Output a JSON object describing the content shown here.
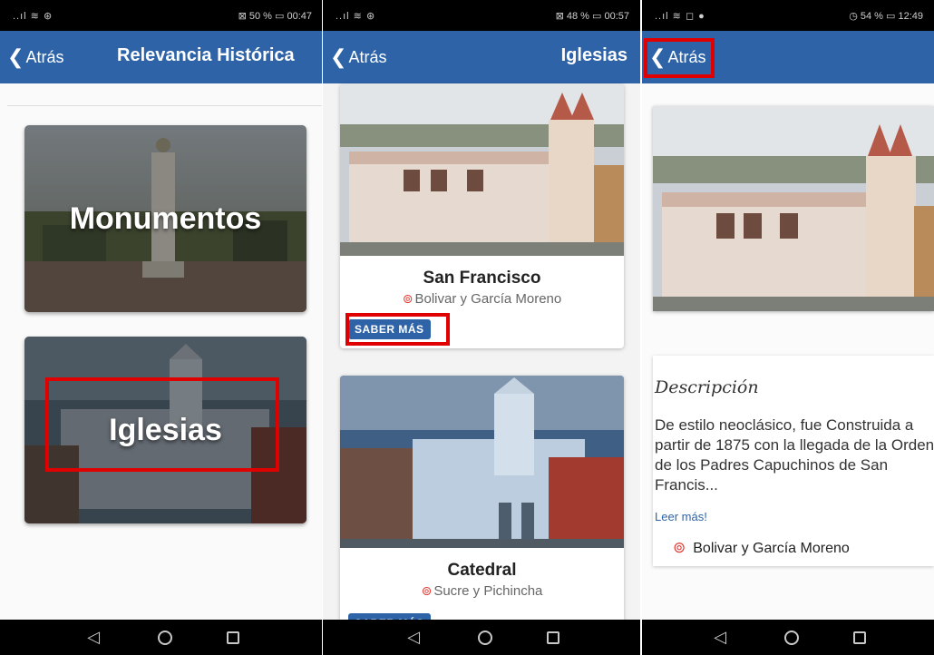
{
  "screens": [
    {
      "status_left": "..ıl ≋ ⊛",
      "status_right": "⊠ 50 % ▭ 00:47",
      "back_label": "Atrás",
      "title": "Relevancia Histórica",
      "categories": [
        {
          "label": "Monumentos"
        },
        {
          "label": "Iglesias"
        }
      ]
    },
    {
      "status_left": "..ıl ≋ ⊛",
      "status_right": "⊠ 48 % ▭ 00:57",
      "back_label": "Atrás",
      "title": "Iglesias",
      "churches": [
        {
          "name": "San Francisco",
          "address": "Bolivar y García Moreno",
          "button": "SABER MÁS"
        },
        {
          "name": "Catedral",
          "address": "Sucre y Pichincha",
          "button": "SABER MÁS"
        }
      ]
    },
    {
      "status_left": "..ıl ≋ ◻ ●",
      "status_right": "◷ 54 % ▭ 12:49",
      "back_label": "Atrás",
      "description_heading": "Descripción",
      "description_text": "De estilo neoclásico, fue Construida a partir de 1875 con la llegada de la Orden de los Padres Capuchinos de San Francis...",
      "read_more": "Leer más!",
      "address": "Bolivar y García Moreno"
    }
  ],
  "colors": {
    "appbar": "#2e63a8",
    "highlight": "#e00000",
    "pin": "#e53935"
  },
  "icons": [
    "back-chevron-icon",
    "location-pin-icon",
    "nav-back-icon",
    "nav-home-icon",
    "nav-recents-icon"
  ]
}
